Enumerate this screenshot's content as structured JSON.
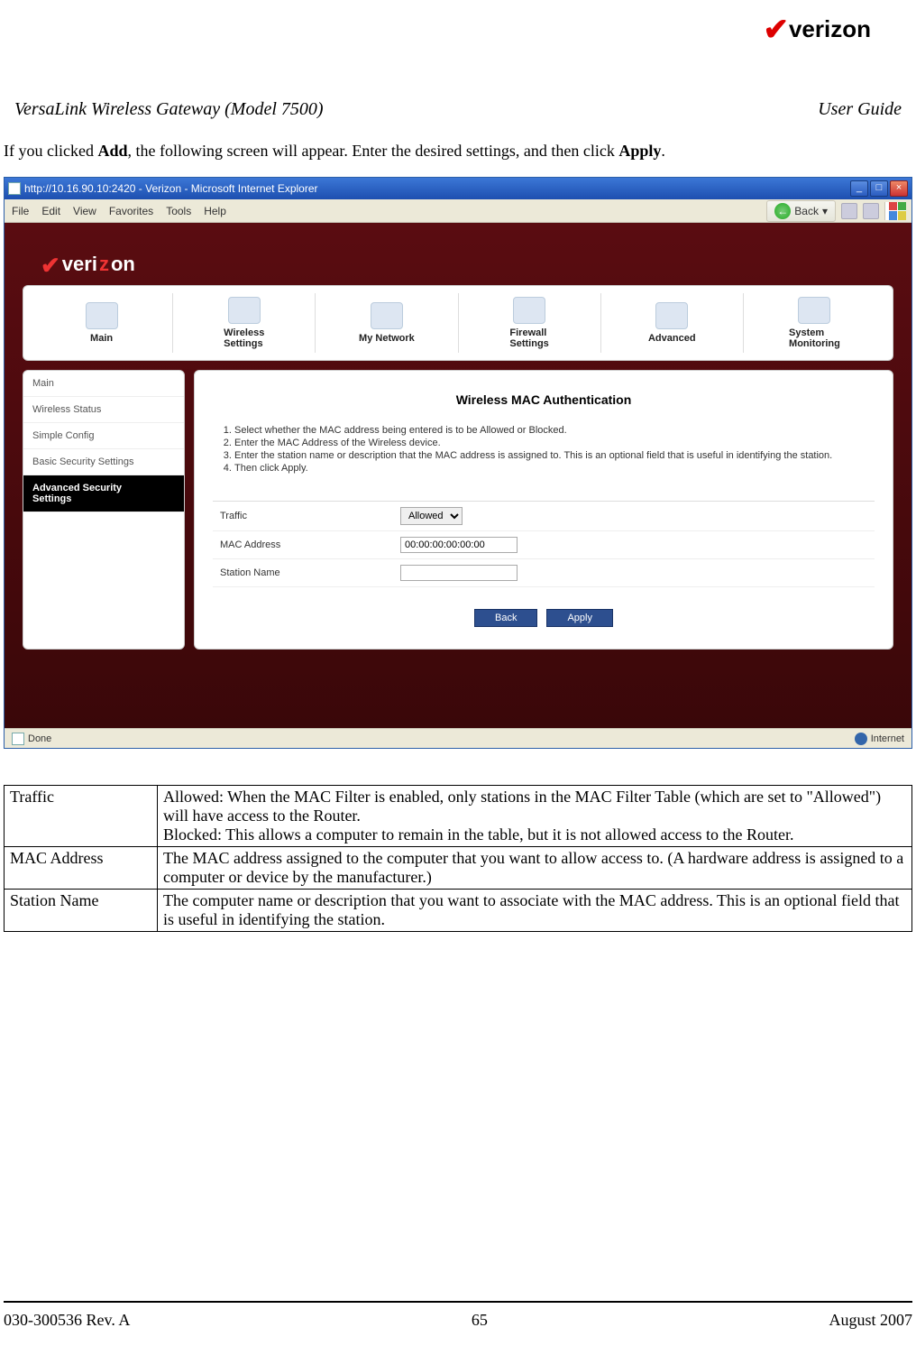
{
  "doc": {
    "product": "VersaLink Wireless Gateway (Model 7500)",
    "guide": "User Guide",
    "intro_pre": "If you clicked ",
    "intro_add": "Add",
    "intro_mid": ", the following screen will appear. Enter the desired settings, and then click ",
    "intro_apply": "Apply",
    "intro_end": ".",
    "rev": "030-300536 Rev. A",
    "page": "65",
    "date": "August 2007",
    "brand": "verizon"
  },
  "browser": {
    "title": "http://10.16.90.10:2420 - Verizon - Microsoft Internet Explorer",
    "menu": [
      "File",
      "Edit",
      "View",
      "Favorites",
      "Tools",
      "Help"
    ],
    "back": "Back",
    "status_left": "Done",
    "status_right": "Internet"
  },
  "page": {
    "logo": "verizon",
    "tabs": [
      "Main",
      "Wireless Settings",
      "My Network",
      "Firewall Settings",
      "Advanced",
      "System Monitoring"
    ],
    "sidebar": [
      "Main",
      "Wireless Status",
      "Simple Config",
      "Basic Security Settings",
      "Advanced Security Settings"
    ],
    "sidebar_active": 4,
    "panel_title": "Wireless MAC Authentication",
    "instructions": [
      "Select whether the MAC address being entered is to be Allowed or Blocked.",
      "Enter the MAC Address of the Wireless device.",
      "Enter the station name or description that the MAC address is assigned to. This is an optional field that is useful in identifying the station.",
      "Then click Apply."
    ],
    "form": {
      "traffic_label": "Traffic",
      "traffic_value": "Allowed",
      "mac_label": "MAC Address",
      "mac_value": "00:00:00:00:00:00",
      "station_label": "Station Name",
      "station_value": ""
    },
    "buttons": {
      "back": "Back",
      "apply": "Apply"
    }
  },
  "defs": {
    "rows": [
      {
        "key": "Traffic",
        "val": "Allowed: When the MAC Filter is enabled, only stations in the MAC Filter Table (which are set to \"Allowed\") will have access to the Router.\nBlocked: This allows a computer to remain in the table, but it is not allowed access to the Router."
      },
      {
        "key": "MAC Address",
        "val": "The MAC address assigned to the computer that you want to allow access to. (A hardware address is assigned to a computer or device by the manufacturer.)"
      },
      {
        "key": "Station Name",
        "val": "The computer name or description that you want to associate with the MAC address. This is an optional field that is useful in identifying the station."
      }
    ]
  }
}
